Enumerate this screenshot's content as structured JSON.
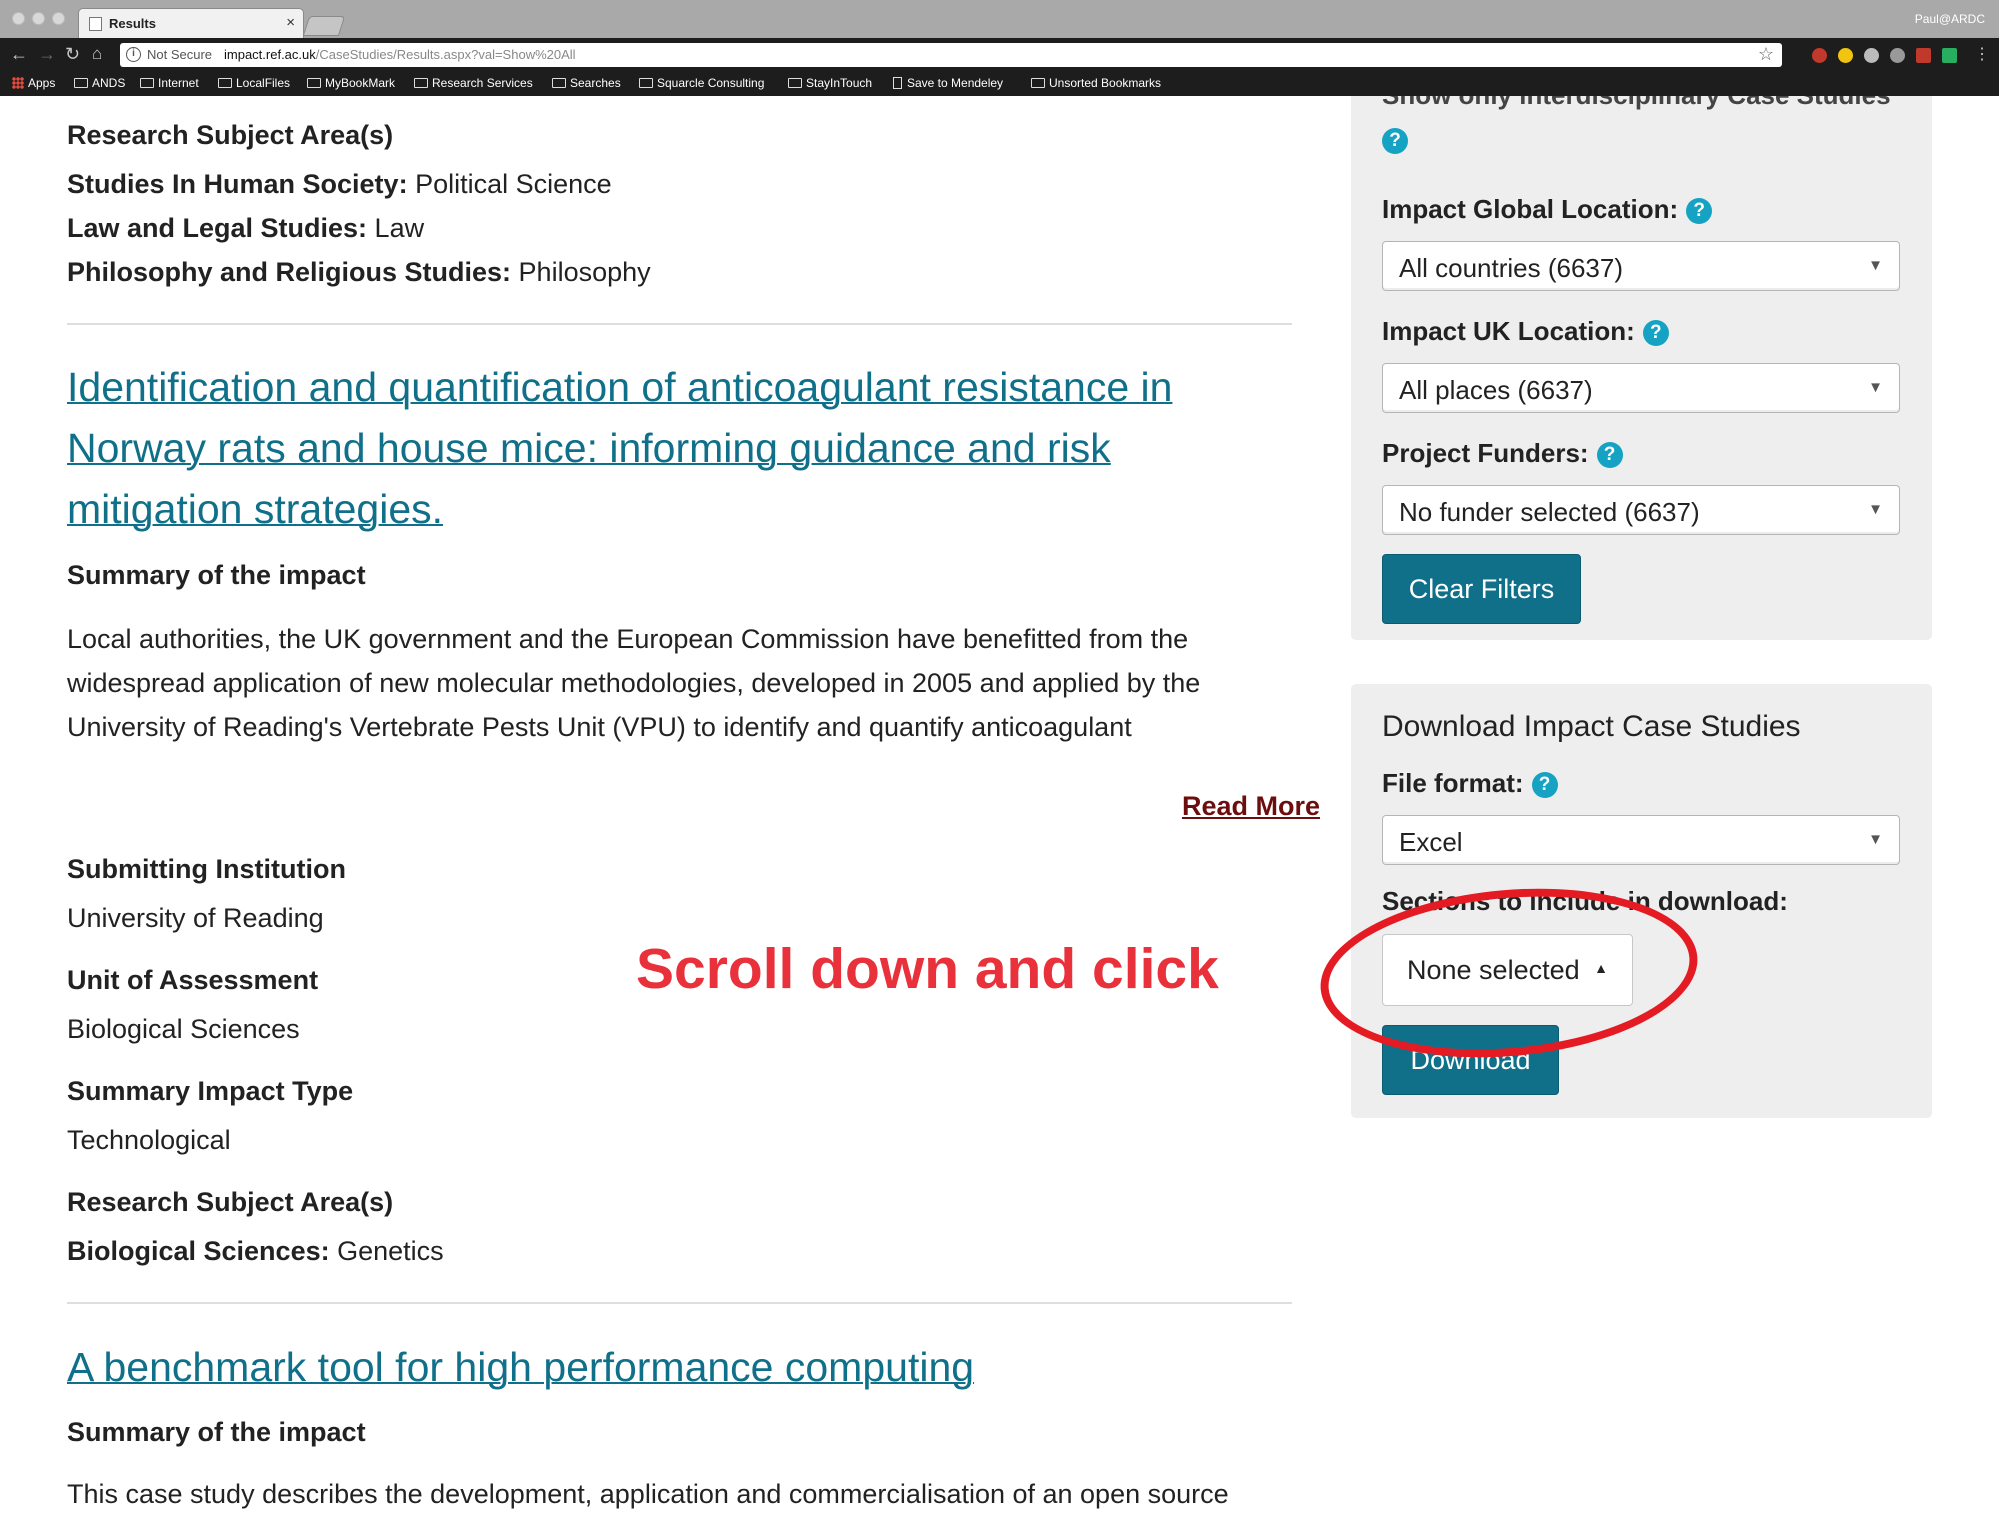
{
  "browser": {
    "tab_title": "Results",
    "tab_close": "×",
    "profile": "Paul@ARDC",
    "security": "Not Secure",
    "url_host": "impact.ref.ac.uk",
    "url_path": "/CaseStudies/Results.aspx?val=Show%20All",
    "bookmarks": [
      "Apps",
      "ANDS",
      "Internet",
      "LocalFiles",
      "MyBookMark",
      "Research Services",
      "Searches",
      "Squarcle Consulting",
      "StayInTouch",
      "Save to Mendeley",
      "Unsorted Bookmarks"
    ]
  },
  "result_top": {
    "rsa_heading": "Research Subject Area(s)",
    "rsa": [
      {
        "label": "Studies In Human Society:",
        "value": " Political Science"
      },
      {
        "label": "Law and Legal Studies:",
        "value": " Law"
      },
      {
        "label": "Philosophy and Religious Studies:",
        "value": " Philosophy"
      }
    ]
  },
  "result_1": {
    "title": "Identification and quantification of anticoagulant resistance in Norway rats and house mice: informing guidance and risk mitigation strategies.",
    "summary_heading": "Summary of the impact",
    "summary": "Local authorities, the UK government and the European Commission have benefitted from the widespread application of new molecular methodologies, developed in 2005 and applied by the University of Reading's Vertebrate Pests Unit (VPU) to identify and quantify anticoagulant",
    "read_more": "Read More",
    "institution_heading": "Submitting Institution",
    "institution": "University of Reading",
    "uoa_heading": "Unit of Assessment",
    "uoa": "Biological Sciences",
    "impact_type_heading": "Summary Impact Type",
    "impact_type": "Technological",
    "rsa_heading": "Research Subject Area(s)",
    "rsa_label": "Biological Sciences:",
    "rsa_value": " Genetics"
  },
  "result_2": {
    "title": "A benchmark tool for high performance computing",
    "summary_heading": "Summary of the impact",
    "summary": "This case study describes the development, application and commercialisation of an open source"
  },
  "annotation": "Scroll down and click",
  "filters": {
    "cut_label": "Show only interdisciplinary Case Studies",
    "help": "?",
    "global_label": "Impact Global Location:",
    "global_value": "All countries (6637)",
    "uk_label": "Impact UK Location:",
    "uk_value": "All places (6637)",
    "funders_label": "Project Funders:",
    "funders_value": "No funder selected (6637)",
    "clear_button": "Clear Filters",
    "arrow": "▼"
  },
  "download": {
    "title": "Download Impact Case Studies",
    "format_label": "File format:",
    "format_value": "Excel",
    "sections_label": "Sections to include in download:",
    "sections_value": "None selected",
    "caret": "▲",
    "download_button": "Download"
  },
  "colors": {
    "link": "#10708a",
    "button": "#10708a",
    "read_more": "#6d0d0d",
    "annotation": "#e8313a",
    "help": "#15a2c3"
  }
}
